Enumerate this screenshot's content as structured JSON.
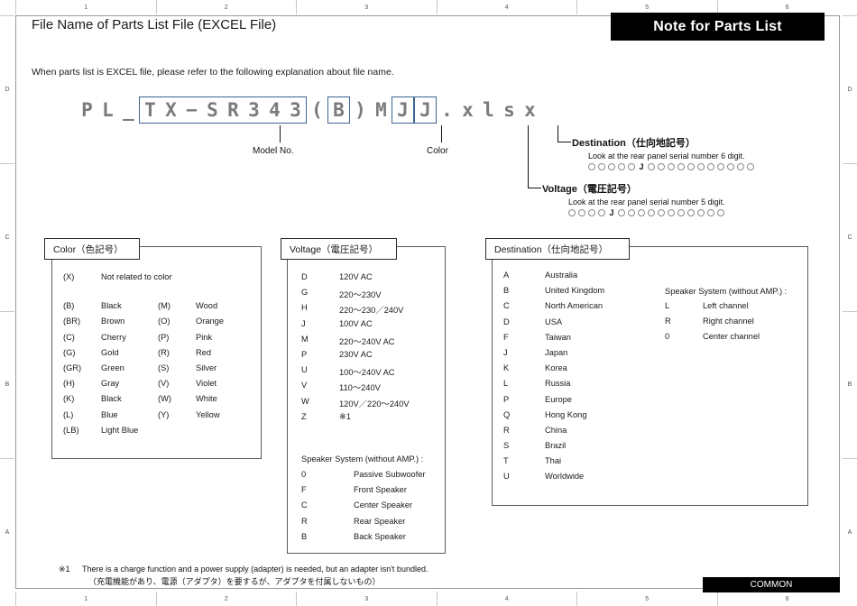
{
  "rulers": {
    "top": [
      "",
      "1",
      "2",
      "3",
      "4",
      "5",
      "6"
    ],
    "bottom": [
      "",
      "1",
      "2",
      "3",
      "4",
      "5",
      "6"
    ],
    "left": [
      "",
      "D",
      "C",
      "B",
      "A"
    ],
    "right": [
      "",
      "D",
      "C",
      "B",
      "A"
    ]
  },
  "header": {
    "title": "File Name of Parts List File (EXCEL File)",
    "banner": "Note for Parts List",
    "intro": "When parts list is EXCEL file, please refer to the following explanation about file name."
  },
  "filename": {
    "prefix": [
      "P",
      "L",
      "_"
    ],
    "model_group": [
      "T",
      "X",
      "−",
      "S",
      "R",
      "3",
      "4",
      "3"
    ],
    "paren_open": "(",
    "color_group": [
      "B"
    ],
    "paren_close": ")",
    "mid": [
      "M"
    ],
    "voltage_group": [
      "J"
    ],
    "destination_group": [
      "J"
    ],
    "suffix": [
      ".",
      "x",
      "l",
      "s",
      "x"
    ]
  },
  "callouts": {
    "model_no": "Model No.",
    "color": "Color",
    "destination": {
      "label": "Destination（仕向地記号）",
      "hint": "Look at the rear panel serial number 6 digit.",
      "circles_before": 5,
      "marker": "J",
      "circles_after": 11
    },
    "voltage": {
      "label": "Voltage（電圧記号）",
      "hint": "Look at the rear panel serial number 5 digit.",
      "circles_before": 4,
      "marker": "J",
      "circles_after": 11
    }
  },
  "color_legend": {
    "title": "Color（色記号）",
    "single": {
      "code": "(X)",
      "name": "Not related to color"
    },
    "col1": [
      {
        "code": "(B)",
        "name": "Black"
      },
      {
        "code": "(BR)",
        "name": "Brown"
      },
      {
        "code": "(C)",
        "name": "Cherry"
      },
      {
        "code": "(G)",
        "name": "Gold"
      },
      {
        "code": "(GR)",
        "name": "Green"
      },
      {
        "code": "(H)",
        "name": "Gray"
      },
      {
        "code": "(K)",
        "name": "Black"
      },
      {
        "code": "(L)",
        "name": "Blue"
      },
      {
        "code": "(LB)",
        "name": "Light Blue"
      }
    ],
    "col2": [
      {
        "code": "(M)",
        "name": "Wood"
      },
      {
        "code": "(O)",
        "name": "Orange"
      },
      {
        "code": "(P)",
        "name": "Pink"
      },
      {
        "code": "(R)",
        "name": "Red"
      },
      {
        "code": "(S)",
        "name": "Silver"
      },
      {
        "code": "(V)",
        "name": "Violet"
      },
      {
        "code": "(W)",
        "name": "White"
      },
      {
        "code": "(Y)",
        "name": "Yellow"
      }
    ]
  },
  "voltage_legend": {
    "title": "Voltage（電圧記号）",
    "rows": [
      {
        "code": "D",
        "name": "120V AC"
      },
      {
        "code": "G",
        "name": "220～230V"
      },
      {
        "code": "H",
        "name": "220～230／240V"
      },
      {
        "code": "J",
        "name": "100V AC"
      },
      {
        "code": "M",
        "name": "220～240V AC"
      },
      {
        "code": "P",
        "name": "230V AC"
      },
      {
        "code": "U",
        "name": "100～240V AC"
      },
      {
        "code": "V",
        "name": "110～240V"
      },
      {
        "code": "W",
        "name": "120V／220～240V"
      },
      {
        "code": "Z",
        "name": "※1"
      }
    ],
    "speaker_title": "Speaker System (without AMP.) :",
    "speaker_rows": [
      {
        "code": "0",
        "name": "Passive Subwoofer"
      },
      {
        "code": "F",
        "name": "Front Speaker"
      },
      {
        "code": "C",
        "name": "Center Speaker"
      },
      {
        "code": "R",
        "name": "Rear  Speaker"
      },
      {
        "code": "B",
        "name": "Back Speaker"
      }
    ]
  },
  "destination_legend": {
    "title": "Destination（仕向地記号）",
    "rows": [
      {
        "code": "A",
        "name": "Australia"
      },
      {
        "code": "B",
        "name": "United Kingdom"
      },
      {
        "code": "C",
        "name": "North American"
      },
      {
        "code": "D",
        "name": "USA"
      },
      {
        "code": "F",
        "name": "Taiwan"
      },
      {
        "code": "J",
        "name": "Japan"
      },
      {
        "code": "K",
        "name": "Korea"
      },
      {
        "code": "L",
        "name": "Russia"
      },
      {
        "code": "P",
        "name": "Europe"
      },
      {
        "code": "Q",
        "name": "Hong Kong"
      },
      {
        "code": "R",
        "name": "China"
      },
      {
        "code": "S",
        "name": "Brazil"
      },
      {
        "code": "T",
        "name": "Thai"
      },
      {
        "code": "U",
        "name": "Worldwide"
      }
    ],
    "speaker_title": "Speaker System (without AMP.) :",
    "speaker_rows": [
      {
        "code": "L",
        "name": "Left channel"
      },
      {
        "code": "R",
        "name": "Right channel"
      },
      {
        "code": "0",
        "name": "Center channel"
      }
    ]
  },
  "footnote": {
    "mark": "※1",
    "line1": "There is a charge function and a power supply (adapter) is needed, but an adapter isn't bundled.",
    "line2": "（充電機能があり、電源（アダプタ）を要するが、アダプタを付属しないもの）"
  },
  "footer": {
    "common": "COMMON"
  },
  "colors": {
    "banner_bg": "#000000",
    "group_box_border": "#3d6591",
    "filename_text": "#7b7b7b",
    "frame_border": "#9a9a9a"
  }
}
